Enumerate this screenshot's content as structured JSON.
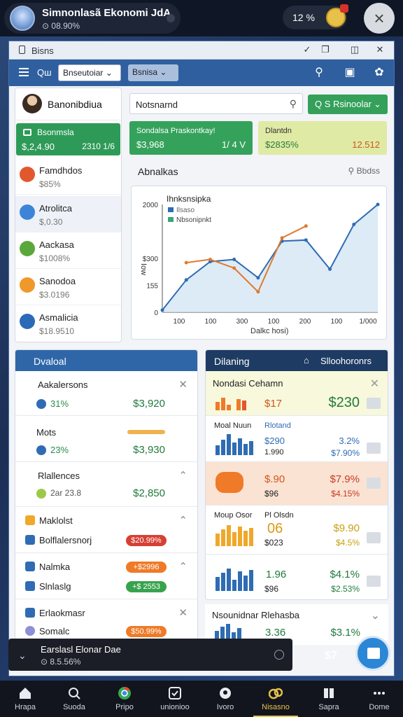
{
  "topbar": {
    "app_title": "Simnonlasã Ekonomi JdA",
    "app_subtitle": "⊙ 08.90%",
    "percent": "12 %"
  },
  "window": {
    "title": "Bisns",
    "ctrl_check": "✓",
    "ctrl_restore": "❐",
    "ctrl_max": "◫",
    "ctrl_close": "✕"
  },
  "toolbar": {
    "label": "Qш",
    "select1": "Bnseutoiar ⌄",
    "select2": "Bsnisa ⌄"
  },
  "sidebar": {
    "user": "Banonibdiua",
    "balance": {
      "title": "Bsonmsla",
      "value": "$,2,4.90",
      "note": "2310 1/6"
    },
    "items": [
      {
        "name": "Famdhdos",
        "value": "$85%",
        "color": "#e2572d"
      },
      {
        "name": "Atrolitca",
        "value": "$,0.30",
        "color": "#3d84d8"
      },
      {
        "name": "Aackasa",
        "value": "$1008%",
        "color": "#5aa83b"
      },
      {
        "name": "Sanodoa",
        "value": "$3.0196",
        "color": "#f0982a"
      },
      {
        "name": "Asmalicia",
        "value": "$18.9510",
        "color": "#2b6ab8"
      }
    ]
  },
  "search": {
    "value": "Notsnarnd"
  },
  "action_button": {
    "label": "Q S Rsinoolar"
  },
  "cards": {
    "green": {
      "a": "Sondalsa Praskontkay!",
      "b": "$3,968",
      "c": "1/ 4 V"
    },
    "yellow": {
      "a": "Dlantdn",
      "b": "$2835%",
      "c": "12.512"
    }
  },
  "analytics": {
    "title": "Abnalkas",
    "filter": "Bbdss"
  },
  "chart_data": {
    "type": "line",
    "title": "Ihnksnsipka",
    "legend": [
      "Ilsaso",
      "Nbsonipnkt"
    ],
    "ylabel": "Iow",
    "xlabel": "Dalkc hosi)",
    "y_ticks": [
      "0",
      "155",
      "$300",
      "2000"
    ],
    "x_ticks": [
      "100",
      "100",
      "300",
      "100",
      "200",
      "100",
      "1/000"
    ],
    "ylim": [
      0,
      2000
    ],
    "series": [
      {
        "name": "Ilsaso",
        "color": "#2f6cb3",
        "values": [
          40,
          600,
          940,
          980,
          640,
          1320,
          1340,
          800,
          1630,
          2000
        ]
      },
      {
        "name": "Nbsonipnkt",
        "color": "#e07a2e",
        "values": [
          null,
          920,
          980,
          820,
          380,
          1380,
          1600,
          null,
          null,
          null
        ]
      }
    ]
  },
  "overview": {
    "title": "Dvaloal",
    "rows": [
      {
        "name": "Aakalersons",
        "pct": "31%",
        "amt": "$3,920"
      },
      {
        "name": "Mots",
        "pct": "23%",
        "amt": "$3,930"
      },
      {
        "name": "Rlallences",
        "pct": "2ar 23.8",
        "amt": "$2,850"
      }
    ],
    "items": [
      {
        "name": "Maklolst",
        "color": "#f0a82a"
      },
      {
        "name": "Bolflalersnorj",
        "badge": "$20.99%",
        "badge_color": "#d64033",
        "color": "#2f6cb3"
      },
      {
        "name": "Nalmka",
        "badge": "+$2996",
        "badge_color": "#ef7a28",
        "color": "#2f6cb3"
      },
      {
        "name": "Slnlaslg",
        "badge": "+$ 2553",
        "badge_color": "#37a34d",
        "color": "#2f6cb3"
      },
      {
        "name": "Erlaokmasr",
        "color": "#2f6cb3"
      },
      {
        "name": "Somalc",
        "badge": "$50.99%",
        "badge_color": "#ef7a28",
        "color": "#8d8fd8"
      }
    ]
  },
  "dp": {
    "title": "Dilaning",
    "right": "Slloohoronrs",
    "rows": [
      {
        "name": "Nondasi Cehamn",
        "v1": "$17",
        "amt": "$230"
      },
      {
        "label1": "Moal Nuun",
        "label2": "Rlotand",
        "v1": "$290",
        "v2": "1.990",
        "pct": "3.2%",
        "pct2": "$7.90%"
      },
      {
        "v1": "$.90",
        "v2": "$96",
        "pct": "$7.9%",
        "pct2": "$4.15%"
      },
      {
        "label1": "Moup Osor",
        "label2": "Pl Olsdn",
        "v1": "06",
        "v2": "$023",
        "pct": "$9.90",
        "pct2": "$4.5%"
      },
      {
        "v1": "1.96",
        "v2": "$96",
        "pct": "$4.1%",
        "pct2": "$2.53%"
      }
    ],
    "footer": {
      "name": "Nsounidnar Rlehasba",
      "v1": "3.36",
      "pct": "$3.1%"
    }
  },
  "toast": {
    "title": "Earslasl Elonar Dae",
    "sub": "⊙ 8.5.56%",
    "right": "$7"
  },
  "nav": [
    "Hrapa",
    "Suoda",
    "Pripo",
    "unionioo",
    "Ivoro",
    "Nisasno",
    "Sapra",
    "Dome"
  ]
}
